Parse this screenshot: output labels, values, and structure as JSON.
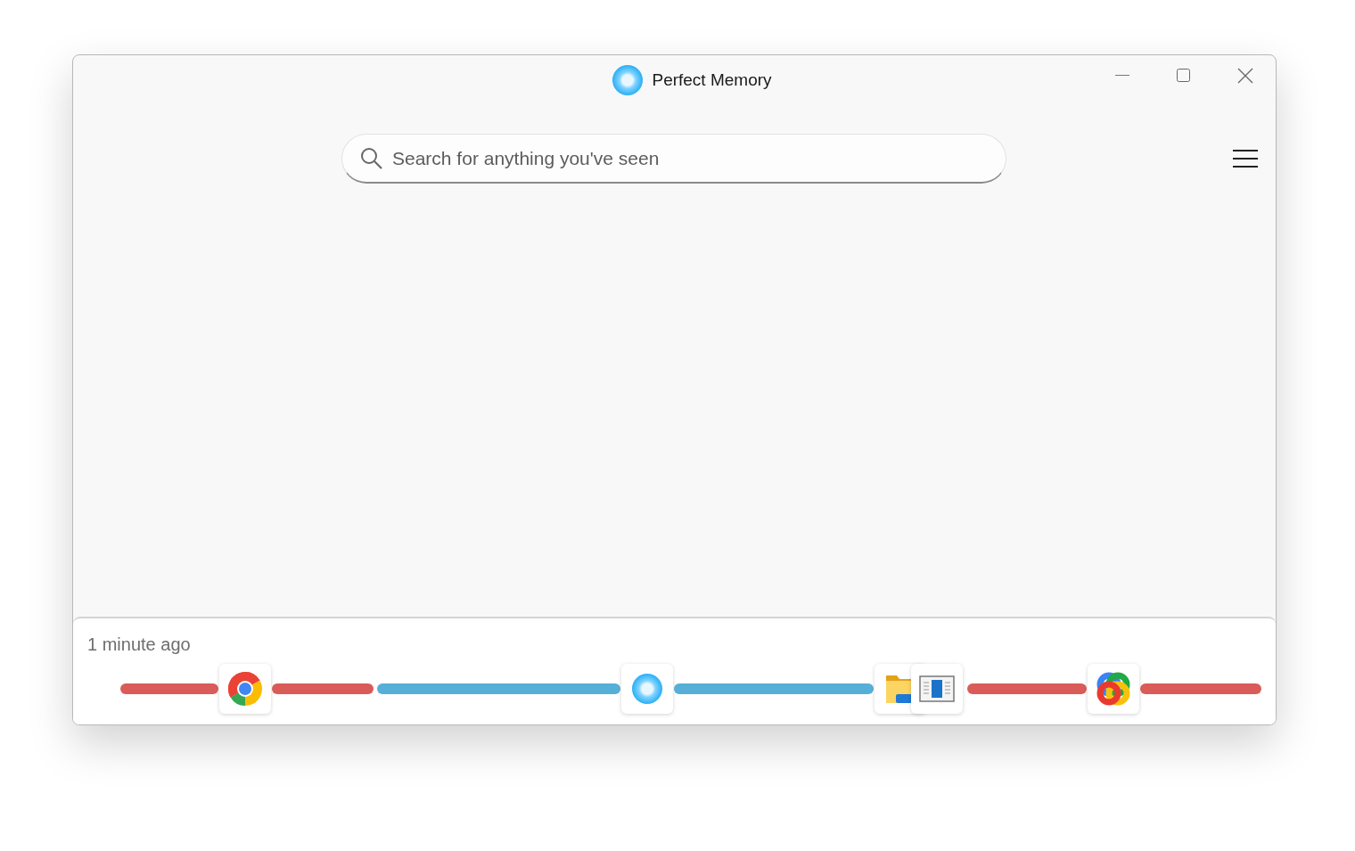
{
  "window": {
    "title": "Perfect Memory"
  },
  "search": {
    "placeholder": "Search for anything you've seen"
  },
  "timeline": {
    "time_label": "1 minute ago",
    "items": [
      {
        "kind": "segment",
        "color": "#d95c58"
      },
      {
        "kind": "app"
      },
      {
        "kind": "segment",
        "color": "#d95c58"
      },
      {
        "kind": "gap"
      },
      {
        "kind": "segment",
        "color": "#56afd6"
      },
      {
        "kind": "app"
      },
      {
        "kind": "segment",
        "color": "#56afd6"
      },
      {
        "kind": "app"
      },
      {
        "kind": "app"
      },
      {
        "kind": "gap"
      },
      {
        "kind": "segment",
        "color": "#d95c58"
      },
      {
        "kind": "app"
      },
      {
        "kind": "segment",
        "color": "#d95c58"
      }
    ]
  }
}
